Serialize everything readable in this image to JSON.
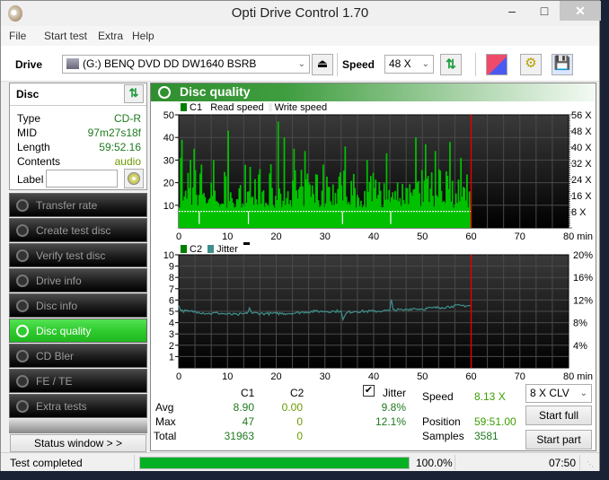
{
  "window": {
    "title": "Opti Drive Control 1.70",
    "minimize": "–",
    "maximize": "□",
    "close": "✕"
  },
  "menu": [
    "File",
    "Start test",
    "Extra",
    "Help"
  ],
  "toolbar": {
    "drive_label": "Drive",
    "drive_value": "(G:)  BENQ DVD DD DW1640 BSRB",
    "speed_label": "Speed",
    "speed_value": "48 X",
    "icons": [
      "eject-icon",
      "refresh-icon",
      "erase-icon",
      "settings-icon",
      "save-icon"
    ]
  },
  "disc": {
    "header": "Disc",
    "rows": [
      {
        "key": "Type",
        "value": "CD-R"
      },
      {
        "key": "MID",
        "value": "97m27s18f"
      },
      {
        "key": "Length",
        "value": "59:52.16"
      },
      {
        "key": "Contents",
        "value": "audio"
      }
    ],
    "label_key": "Label",
    "label_value": ""
  },
  "nav": [
    {
      "label": "Transfer rate",
      "active": false
    },
    {
      "label": "Create test disc",
      "active": false
    },
    {
      "label": "Verify test disc",
      "active": false
    },
    {
      "label": "Drive info",
      "active": false
    },
    {
      "label": "Disc info",
      "active": false
    },
    {
      "label": "Disc quality",
      "active": true
    },
    {
      "label": "CD Bler",
      "active": false
    },
    {
      "label": "FE / TE",
      "active": false
    },
    {
      "label": "Extra tests",
      "active": false
    }
  ],
  "status_window_label": "Status window > >",
  "panel": {
    "title": "Disc quality",
    "legend1": {
      "c1": "C1",
      "read": "Read speed",
      "write": "Write speed"
    },
    "legend2": {
      "c2": "C2",
      "jitter": "Jitter"
    }
  },
  "stats": {
    "col_c1": "C1",
    "col_c2": "C2",
    "jitter_label": "Jitter",
    "jitter_checked": true,
    "rows": [
      {
        "label": "Avg",
        "c1": "8.90",
        "c2": "0.00",
        "jitter": "9.8%"
      },
      {
        "label": "Max",
        "c1": "47",
        "c2": "0",
        "jitter": "12.1%"
      },
      {
        "label": "Total",
        "c1": "31963",
        "c2": "0",
        "jitter": ""
      }
    ],
    "speed_label": "Speed",
    "speed_value": "8.13 X",
    "position_label": "Position",
    "position_value": "59:51.00",
    "samples_label": "Samples",
    "samples_value": "3581",
    "speed_mode": "8 X CLV",
    "start_full": "Start full",
    "start_part": "Start part"
  },
  "statusbar": {
    "text": "Test completed",
    "progress": 100.0,
    "progress_label": "100.0%",
    "elapsed": "07:50"
  },
  "chart_data": [
    {
      "type": "bar",
      "title": "C1 / Read speed",
      "xlabel": "min",
      "x_ticks": [
        "0",
        "10",
        "20",
        "30",
        "40",
        "50",
        "60",
        "70",
        "80 min"
      ],
      "xlim": [
        0,
        80
      ],
      "ylim": [
        0,
        50
      ],
      "y_ticks": [
        "10",
        "20",
        "30",
        "40",
        "50"
      ],
      "y2_ticks": [
        "8 X",
        "16 X",
        "24 X",
        "32 X",
        "40 X",
        "48 X",
        "56 X"
      ],
      "y2lim": [
        0,
        56
      ],
      "legend": [
        "C1",
        "Read speed",
        "Write speed"
      ],
      "end_marker_min": 60,
      "series": [
        {
          "name": "C1",
          "color": "#00c000",
          "avg": 8.9,
          "max": 47,
          "peaks": [
            [
              0.3,
              31
            ],
            [
              0.6,
              39
            ],
            [
              2.2,
              30
            ],
            [
              3.1,
              35
            ],
            [
              4.4,
              28
            ],
            [
              7.0,
              30
            ],
            [
              9.9,
              43
            ],
            [
              14.6,
              27
            ],
            [
              16.5,
              26
            ],
            [
              20.2,
              47
            ],
            [
              21.5,
              40
            ],
            [
              23.5,
              35
            ],
            [
              25.8,
              34
            ],
            [
              29.5,
              28
            ],
            [
              34.0,
              36
            ],
            [
              38.5,
              30
            ],
            [
              42.5,
              33
            ],
            [
              48.5,
              40
            ],
            [
              50.5,
              37
            ],
            [
              52.5,
              34
            ],
            [
              55.5,
              38
            ],
            [
              57.8,
              31
            ]
          ]
        },
        {
          "name": "Read speed",
          "color": "#ffffff",
          "value_x": 8.13
        }
      ]
    },
    {
      "type": "line",
      "title": "C2 / Jitter",
      "xlabel": "min",
      "x_ticks": [
        "0",
        "10",
        "20",
        "30",
        "40",
        "50",
        "60",
        "70",
        "80 min"
      ],
      "xlim": [
        0,
        80
      ],
      "ylim": [
        0,
        10
      ],
      "y_ticks": [
        "1",
        "2",
        "3",
        "4",
        "5",
        "6",
        "7",
        "8",
        "9",
        "10"
      ],
      "y2_ticks": [
        "4%",
        "8%",
        "12%",
        "16%",
        "20%"
      ],
      "y2lim": [
        0,
        20
      ],
      "legend": [
        "C2",
        "Jitter"
      ],
      "end_marker_min": 60,
      "series": [
        {
          "name": "C2",
          "color": "#008000",
          "values": []
        },
        {
          "name": "Jitter",
          "color": "#3f8f8a",
          "unit": "%",
          "points": [
            [
              0,
              11.0
            ],
            [
              0.5,
              10.1
            ],
            [
              2,
              10.0
            ],
            [
              4,
              9.9
            ],
            [
              6,
              9.6
            ],
            [
              8,
              9.7
            ],
            [
              10,
              9.5
            ],
            [
              12,
              9.4
            ],
            [
              14,
              9.6
            ],
            [
              14.5,
              10.6
            ],
            [
              15,
              9.7
            ],
            [
              18,
              9.6
            ],
            [
              20,
              9.6
            ],
            [
              24,
              9.7
            ],
            [
              26,
              9.9
            ],
            [
              28,
              10.0
            ],
            [
              30,
              10.0
            ],
            [
              32,
              10.0
            ],
            [
              33.3,
              10.1
            ],
            [
              33.7,
              8.5
            ],
            [
              34.5,
              9.8
            ],
            [
              36,
              10.0
            ],
            [
              40,
              10.0
            ],
            [
              42,
              10.1
            ],
            [
              43.3,
              10.1
            ],
            [
              43.6,
              12.1
            ],
            [
              44,
              10.3
            ],
            [
              46,
              10.2
            ],
            [
              48,
              10.5
            ],
            [
              50,
              10.4
            ],
            [
              52,
              10.6
            ],
            [
              54,
              10.7
            ],
            [
              56,
              10.9
            ],
            [
              58,
              11.0
            ],
            [
              60,
              11.0
            ]
          ]
        }
      ]
    }
  ]
}
